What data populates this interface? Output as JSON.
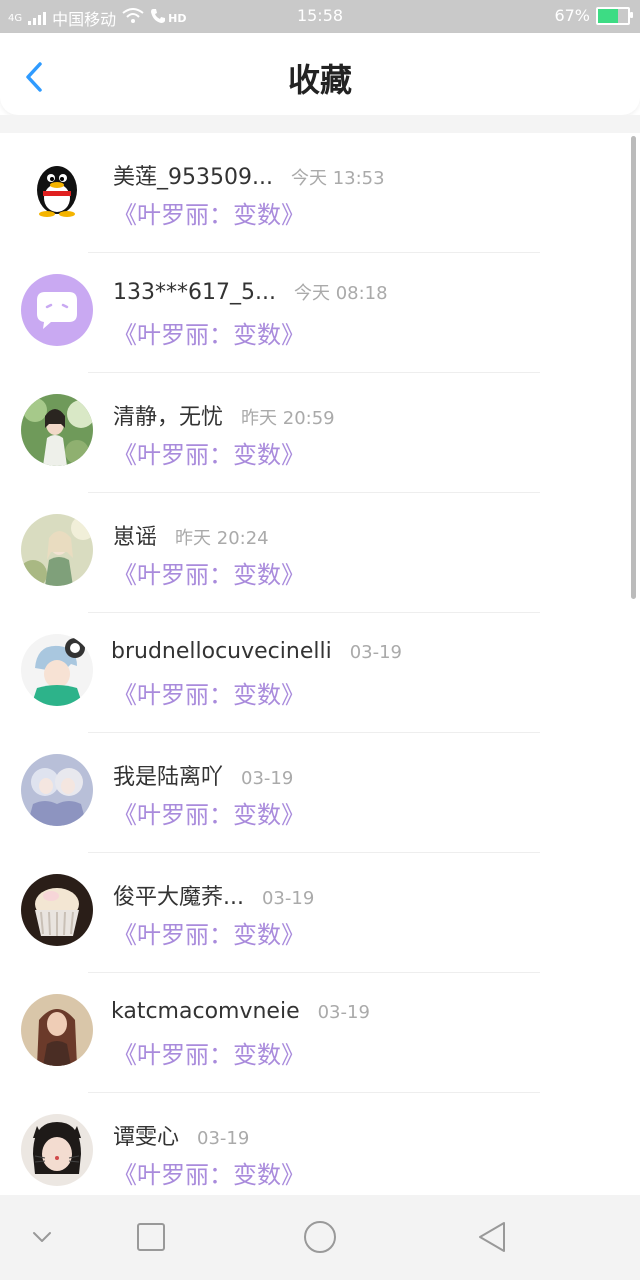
{
  "status_bar": {
    "network": "4G",
    "carrier": "中国移动",
    "hd": "HD",
    "time": "15:58",
    "battery_text": "67%",
    "battery_level": 0.67
  },
  "header": {
    "title": "收藏"
  },
  "items": [
    {
      "name": "美莲_953509...",
      "time": "今天 13:53",
      "book": "《叶罗丽：变数》"
    },
    {
      "name": "133***617_5...",
      "time": "今天 08:18",
      "book": "《叶罗丽：变数》"
    },
    {
      "name": "清静，无忧",
      "time": "昨天 20:59",
      "book": "《叶罗丽：变数》"
    },
    {
      "name": "崽谣",
      "time": "昨天 20:24",
      "book": "《叶罗丽：变数》"
    },
    {
      "name": "brudnellocuvecinelli",
      "time": "03-19",
      "book": "《叶罗丽：变数》"
    },
    {
      "name": "我是陆离吖",
      "time": "03-19",
      "book": "《叶罗丽：变数》"
    },
    {
      "name": "俊平大魔荞...",
      "time": "03-19",
      "book": "《叶罗丽：变数》"
    },
    {
      "name": "katcmacomvneie",
      "time": "03-19",
      "book": "《叶罗丽：变数》"
    },
    {
      "name": "谭雯心",
      "time": "03-19",
      "book": "《叶罗丽：变数》"
    }
  ],
  "colors": {
    "accent": "#2f9bff",
    "book_title": "#a98bdc",
    "time": "#aaaaaa"
  }
}
